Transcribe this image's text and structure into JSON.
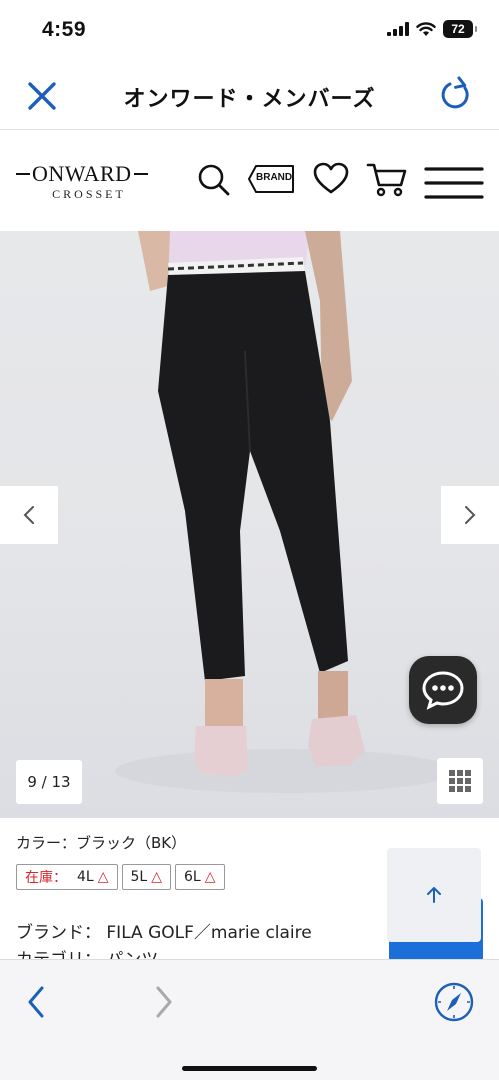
{
  "status_bar": {
    "time": "4:59",
    "battery": "72"
  },
  "nav": {
    "title": "オンワード・メンバーズ",
    "close_icon": "close-icon",
    "reload_icon": "reload-icon"
  },
  "header": {
    "logo_main": "ONWARD",
    "logo_sub": "CROSSET",
    "brand_label": "BRAND",
    "icons": [
      "search-icon",
      "brand-tag-icon",
      "heart-icon",
      "cart-icon",
      "menu-icon"
    ]
  },
  "gallery": {
    "counter": "9 / 13",
    "current": 9,
    "total": 13
  },
  "product": {
    "color": "カラー：ブラック（BK）",
    "stock_label": "在庫：",
    "sizes": [
      {
        "size": "4L",
        "mark": "△"
      },
      {
        "size": "5L",
        "mark": "△"
      },
      {
        "size": "6L",
        "mark": "△"
      }
    ],
    "brand": "ブランド： FILA GOLF／marie claire",
    "category": "カテゴリ： パンツ"
  },
  "colors": {
    "accent": "#1c5fb8",
    "stock_red": "#d9262c",
    "badge_blue": "#1c6fd8"
  }
}
